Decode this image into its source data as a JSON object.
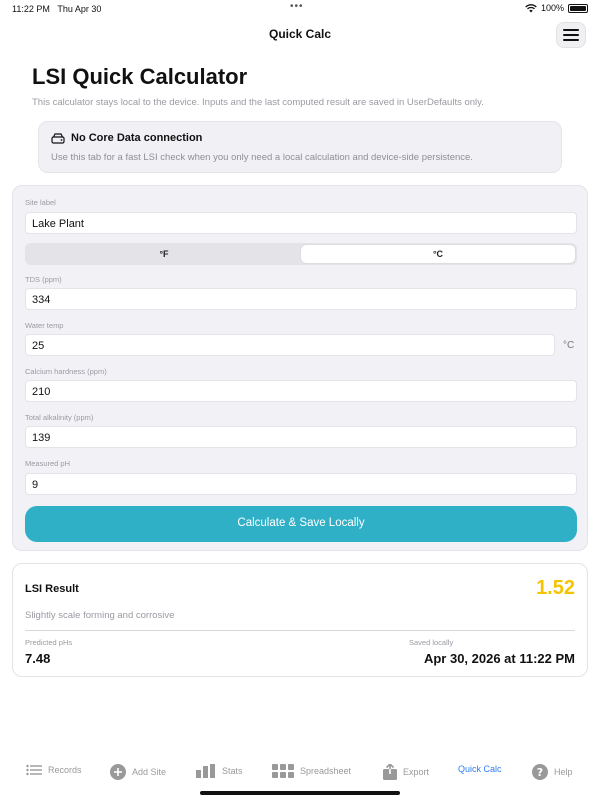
{
  "status": {
    "time": "11:22 PM",
    "date": "Thu Apr 30",
    "dots": "•••",
    "battery": "100%"
  },
  "nav": {
    "title": "Quick Calc",
    "menu_icon": "hamburger-icon"
  },
  "header": {
    "title": "LSI Quick Calculator",
    "subtitle": "This calculator stays local to the device. Inputs and the last computed result are saved in UserDefaults only."
  },
  "notice": {
    "title": "No Core Data connection",
    "body": "Use this tab for a fast LSI check when you only need a local calculation and device-side persistence.",
    "icon": "drive-icon"
  },
  "form": {
    "site_label": "Site label",
    "site_value": "Lake Plant",
    "unit_options": [
      "°F",
      "°C"
    ],
    "unit_selected": "°C",
    "tds_label": "TDS (ppm)",
    "tds_value": "334",
    "temp_label": "Water temp",
    "temp_value": "25",
    "temp_unit": "°C",
    "calcium_label": "Calcium hardness (ppm)",
    "calcium_value": "210",
    "alkalinity_label": "Total alkalinity (ppm)",
    "alkalinity_value": "139",
    "ph_label": "Measured pH",
    "ph_value": "9",
    "button": "Calculate & Save Locally"
  },
  "result": {
    "title": "LSI Result",
    "value": "1.52",
    "description": "Slightly scale forming and corrosive",
    "phs_label": "Predicted pHs",
    "phs_value": "7.48",
    "saved_label": "Saved locally",
    "saved_value": "Apr 30, 2026 at 11:22 PM"
  },
  "colors": {
    "accent": "#30b0c7",
    "result_value": "#f5c400",
    "active_tab": "#2f7cf6"
  },
  "tabs": [
    {
      "label": "Records",
      "icon": "list-icon",
      "active": false
    },
    {
      "label": "Add Site",
      "icon": "plus-circle-icon",
      "active": false
    },
    {
      "label": "Stats",
      "icon": "bar-chart-icon",
      "active": false
    },
    {
      "label": "Spreadsheet",
      "icon": "grid-icon",
      "active": false
    },
    {
      "label": "Export",
      "icon": "share-icon",
      "active": false
    },
    {
      "label": "Quick Calc",
      "icon": "",
      "active": true
    },
    {
      "label": "Help",
      "icon": "help-circle-icon",
      "active": false
    }
  ]
}
